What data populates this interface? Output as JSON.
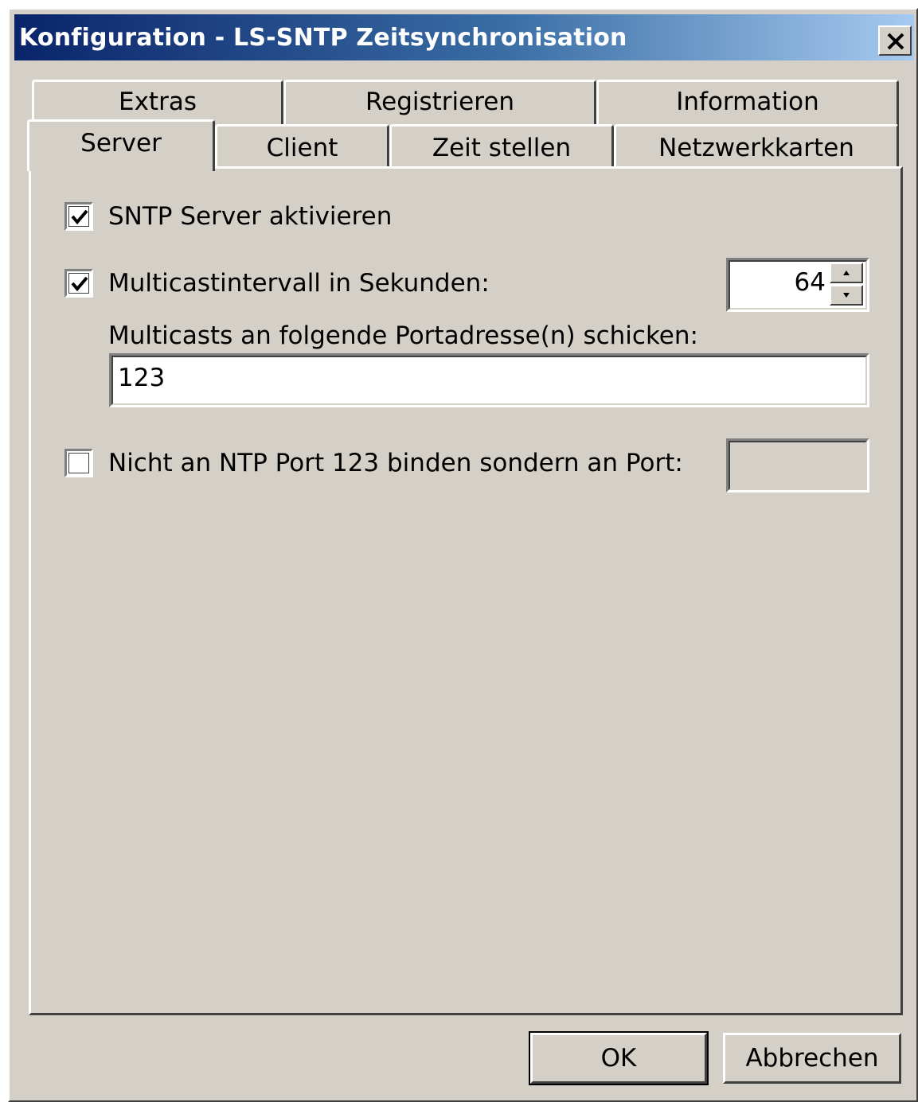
{
  "window": {
    "title": "Konfiguration - LS-SNTP Zeitsynchronisation",
    "close_icon": "close-icon"
  },
  "tabs": {
    "row_back": [
      {
        "label": "Extras"
      },
      {
        "label": "Registrieren"
      },
      {
        "label": "Information"
      }
    ],
    "row_front": [
      {
        "label": "Server",
        "selected": true
      },
      {
        "label": "Client"
      },
      {
        "label": "Zeit stellen"
      },
      {
        "label": "Netzwerkkarten"
      }
    ]
  },
  "server_tab": {
    "enable_server": {
      "label": "SNTP Server aktivieren",
      "checked": true
    },
    "multicast_interval": {
      "label": "Multicastintervall in Sekunden:",
      "checked": true,
      "value": "64"
    },
    "multicast_ports": {
      "label": "Multicasts an folgende Portadresse(n) schicken:",
      "value": "123"
    },
    "custom_port": {
      "label": "Nicht an NTP Port 123 binden sondern an Port:",
      "checked": false,
      "value": ""
    }
  },
  "buttons": {
    "ok": "OK",
    "cancel": "Abbrechen"
  }
}
